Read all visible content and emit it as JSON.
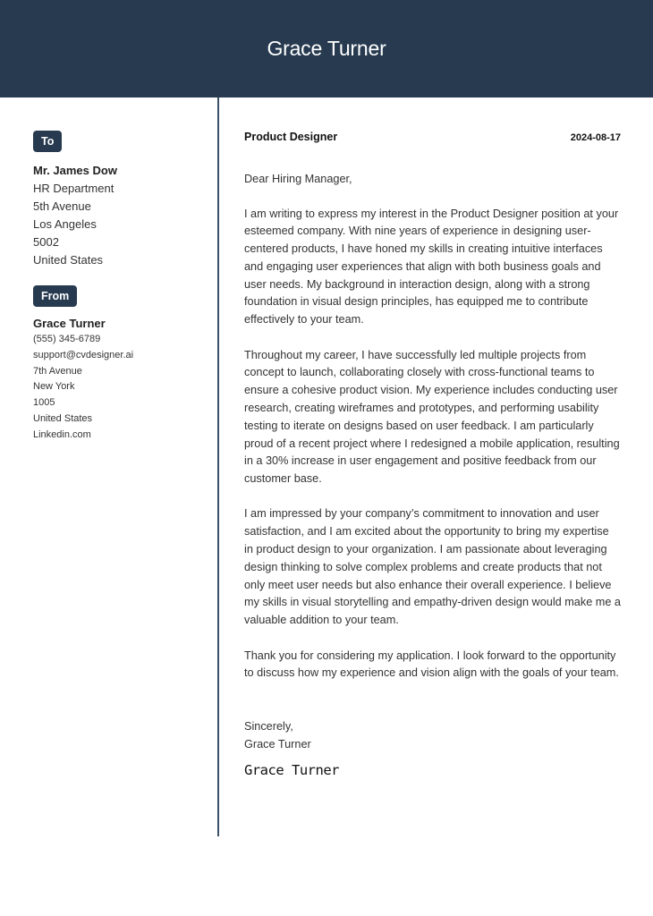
{
  "header": {
    "name": "Grace Turner"
  },
  "colors": {
    "brand": "#273a50",
    "divider": "#3c5068"
  },
  "recipient": {
    "badge": "To",
    "name": "Mr. James Dow",
    "lines": [
      "HR Department",
      "5th Avenue",
      "Los Angeles",
      "5002",
      "United States"
    ]
  },
  "sender": {
    "badge": "From",
    "name": "Grace Turner",
    "lines": [
      "(555) 345-6789",
      "support@cvdesigner.ai",
      "7th Avenue",
      "New York",
      "1005",
      "United States",
      "Linkedin.com"
    ]
  },
  "letter": {
    "position": "Product Designer",
    "date": "2024-08-17",
    "salutation": "Dear Hiring Manager,",
    "paragraphs": [
      "I am writing to express my interest in the Product Designer position at your esteemed company. With nine years of experience in designing user-centered products, I have honed my skills in creating intuitive interfaces and engaging user experiences that align with both business goals and user needs. My background in interaction design, along with a strong foundation in visual design principles, has equipped me to contribute effectively to your team.",
      "Throughout my career, I have successfully led multiple projects from concept to launch, collaborating closely with cross-functional teams to ensure a cohesive product vision. My experience includes conducting user research, creating wireframes and prototypes, and performing usability testing to iterate on designs based on user feedback. I am particularly proud of a recent project where I redesigned a mobile application, resulting in a 30% increase in user engagement and positive feedback from our customer base.",
      "I am impressed by your company’s commitment to innovation and user satisfaction, and I am excited about the opportunity to bring my expertise in product design to your organization. I am passionate about leveraging design thinking to solve complex problems and create products that not only meet user needs but also enhance their overall experience. I believe my skills in visual storytelling and empathy-driven design would make me a valuable addition to your team.",
      "Thank you for considering my application. I look forward to the opportunity to discuss how my experience and vision align with the goals of your team."
    ],
    "closing": "Sincerely,",
    "closing_name": "Grace Turner",
    "signature": "Grace Turner"
  }
}
